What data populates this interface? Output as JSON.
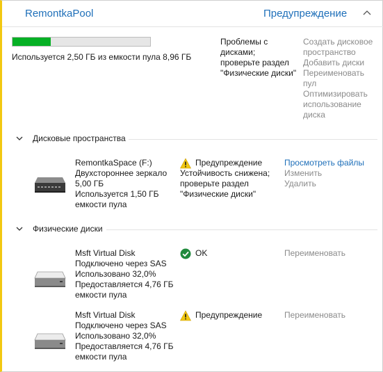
{
  "pool": {
    "name": "RemontkaPool",
    "status": "Предупреждение",
    "usage_fraction": 0.279,
    "usage_text": "Используется 2,50 ГБ из емкости пула 8,96 ГБ",
    "problem_text": "Проблемы с дисками; проверьте раздел \"Физические диски\"",
    "actions": [
      "Создать дисковое пространство",
      "Добавить диски",
      "Переименовать пул",
      "Оптимизировать использование диска"
    ],
    "colors": {
      "accent": "#1e6fb9",
      "warning_stripe": "#f2c811",
      "usage_fill": "#06b025",
      "disabled": "#8a8a8a"
    }
  },
  "spaces": {
    "title": "Дисковые пространства",
    "items": [
      {
        "name": "RemontkaSpace (F:)",
        "lines": [
          "Двухстороннее зеркало",
          "5,00 ГБ",
          "Используется 1,50 ГБ",
          "емкости пула"
        ],
        "status_icon": "warning-icon",
        "status": "Предупреждение",
        "status_detail": "Устойчивость снижена; проверьте раздел \"Физические диски\"",
        "actions": [
          "Просмотреть файлы",
          "Изменить",
          "Удалить"
        ]
      }
    ]
  },
  "disks": {
    "title": "Физические диски",
    "items": [
      {
        "name": "Msft Virtual Disk",
        "lines": [
          "Подключено через SAS",
          "Использовано 32,0%",
          "Предоставляется 4,76 ГБ",
          "емкости пула"
        ],
        "status_icon": "ok-icon",
        "status": "OK",
        "action": "Переименовать"
      },
      {
        "name": "Msft Virtual Disk",
        "lines": [
          "Подключено через SAS",
          "Использовано 32,0%",
          "Предоставляется 4,76 ГБ",
          "емкости пула"
        ],
        "status_icon": "warning-icon",
        "status": "Предупреждение",
        "action": "Переименовать"
      }
    ]
  }
}
